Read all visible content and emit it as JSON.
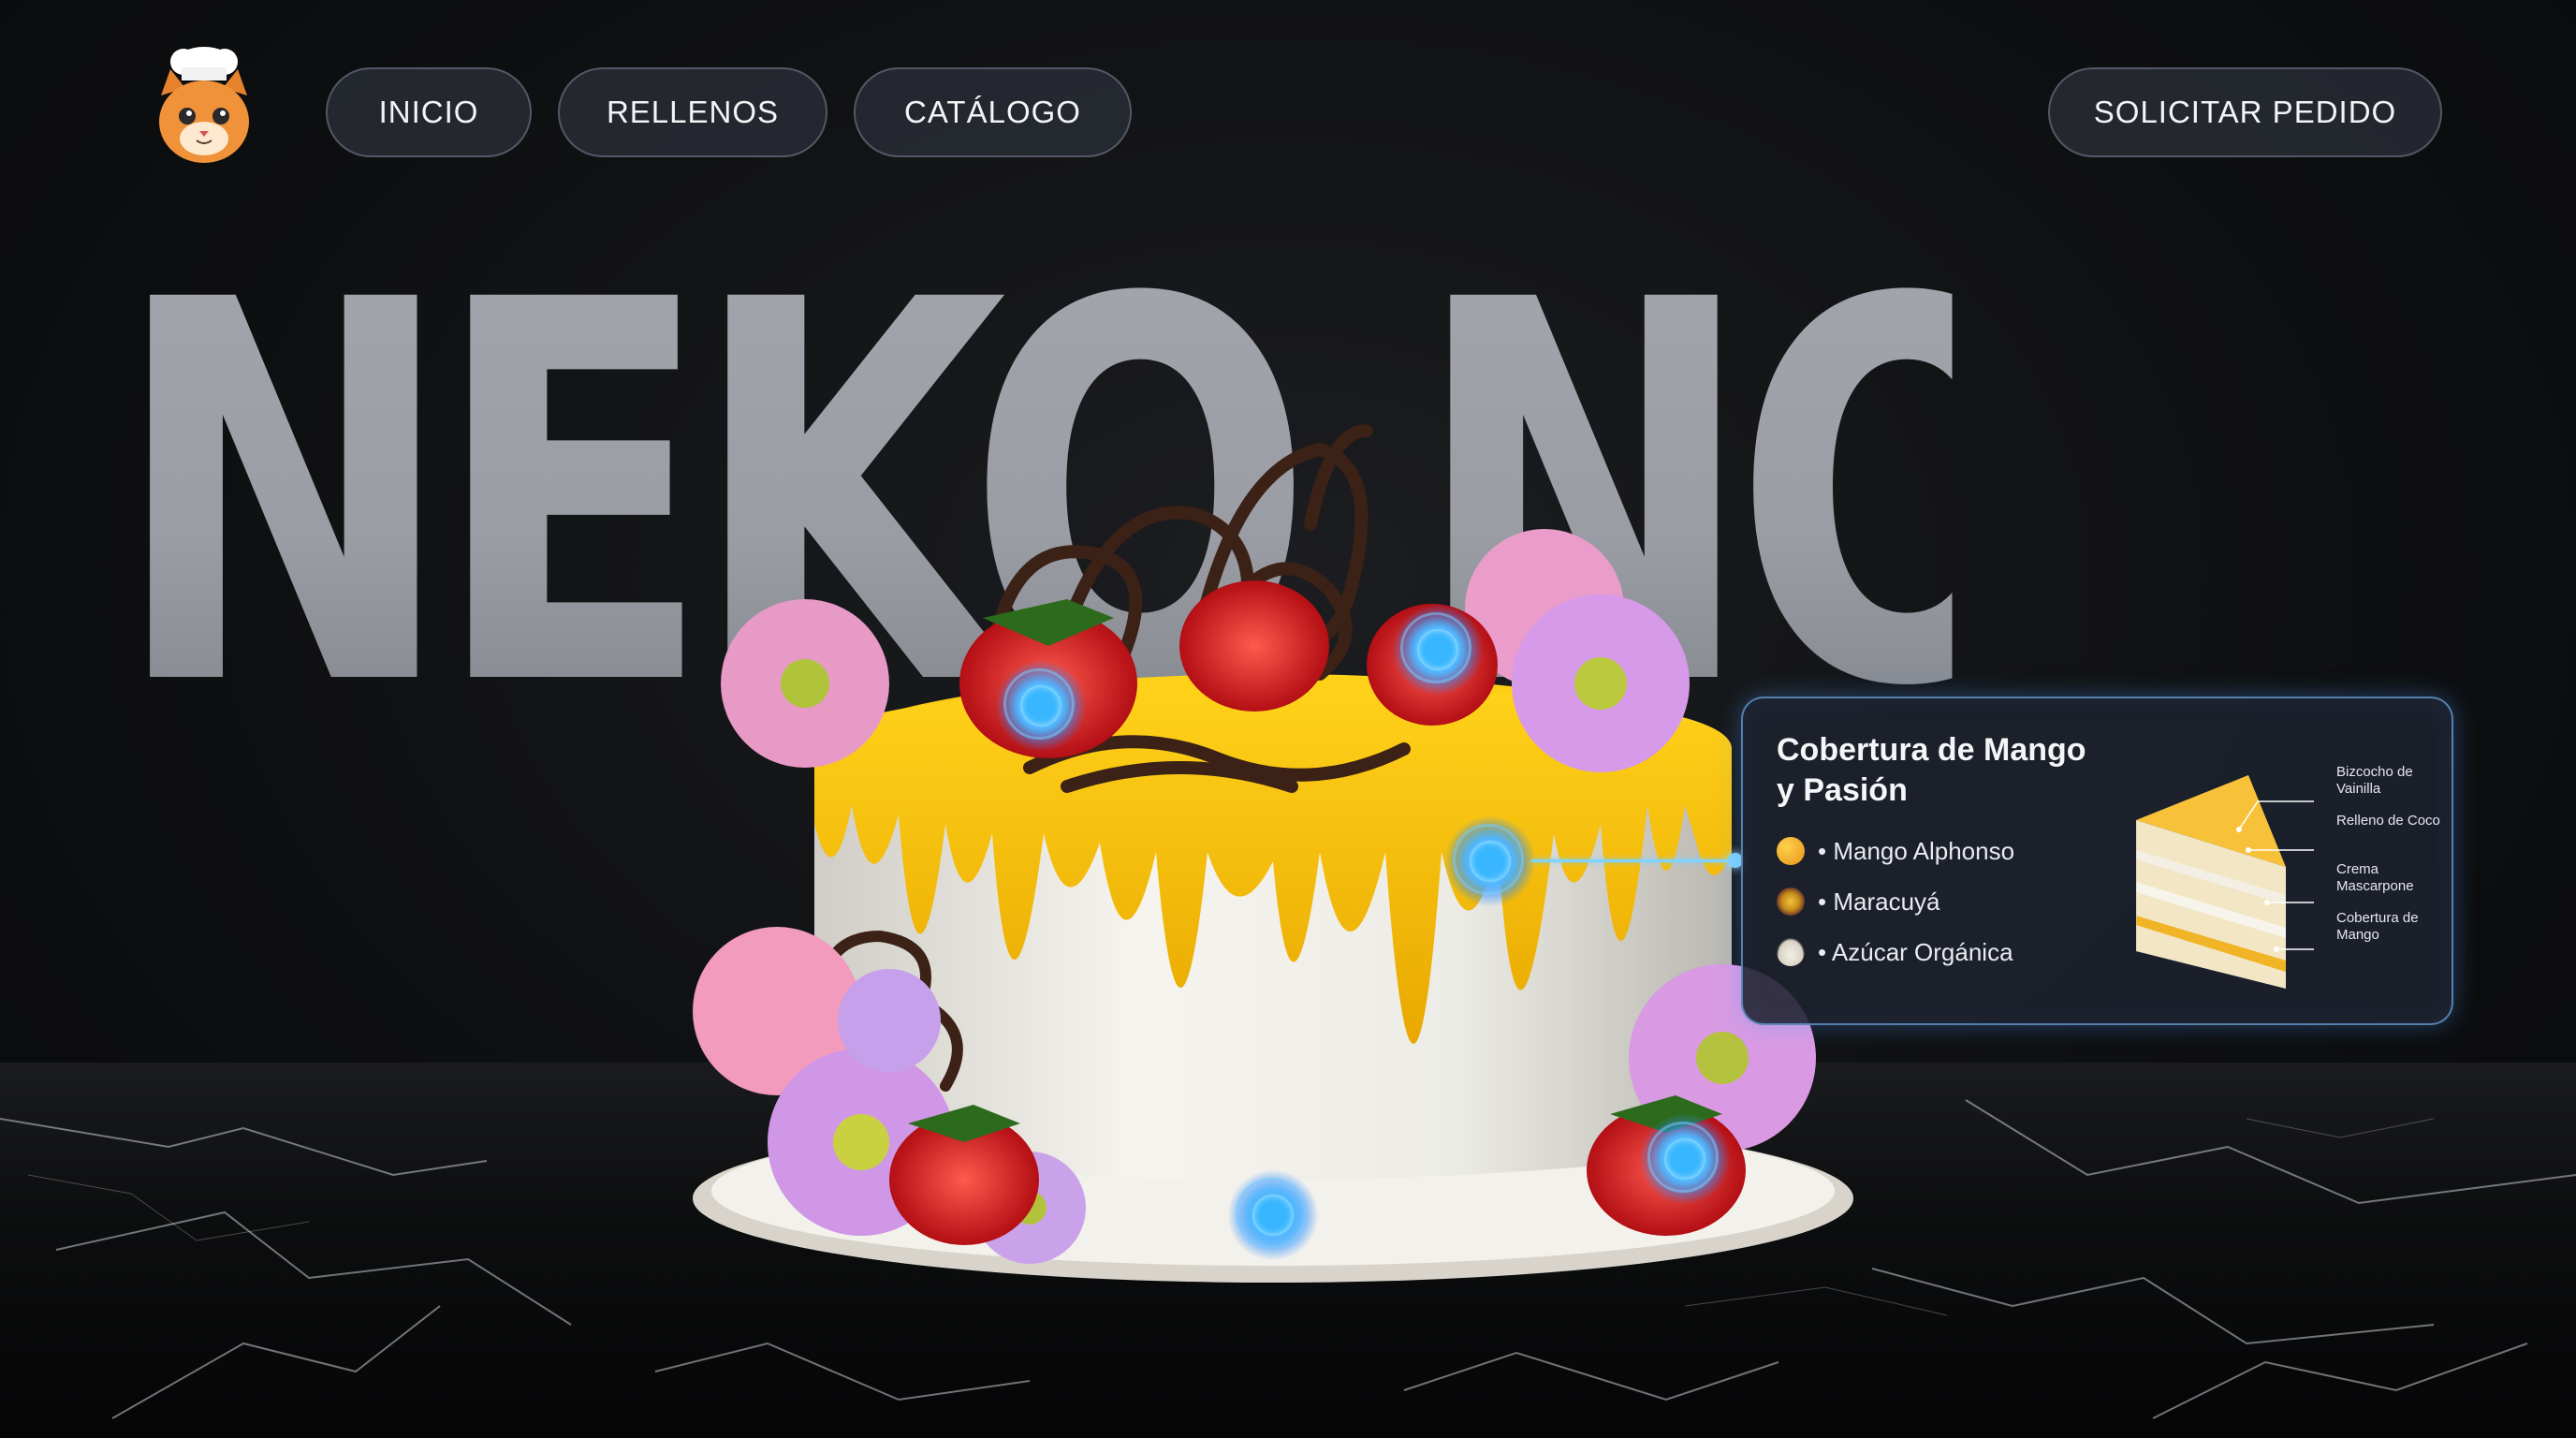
{
  "brand": {
    "logo_icon": "chef-cat-icon"
  },
  "nav": {
    "items": [
      {
        "label": "INICIO"
      },
      {
        "label": "RELLENOS"
      },
      {
        "label": "CATÁLOGO"
      }
    ],
    "cta_label": "SOLICITAR PEDIDO"
  },
  "hero": {
    "title": "NEKO NO KEKI"
  },
  "info_card": {
    "title": "Cobertura de Mango y Pasión",
    "ingredients": [
      {
        "label": "• Mango Alphonso",
        "icon": "mango-icon"
      },
      {
        "label": "• Maracuyá",
        "icon": "passion-fruit-icon"
      },
      {
        "label": "• Azúcar Orgánica",
        "icon": "sugar-icon"
      }
    ],
    "layers": [
      {
        "label": "Bizcocho de Vainilla"
      },
      {
        "label": "Relleno de Coco"
      },
      {
        "label": "Crema Mascarpone"
      },
      {
        "label": "Cobertura de Mango"
      }
    ]
  },
  "colors": {
    "background": "#0e0f11",
    "accent_blue": "#38b6ff",
    "mango_glaze": "#f2b705",
    "title_gray": "#9a9da4"
  }
}
